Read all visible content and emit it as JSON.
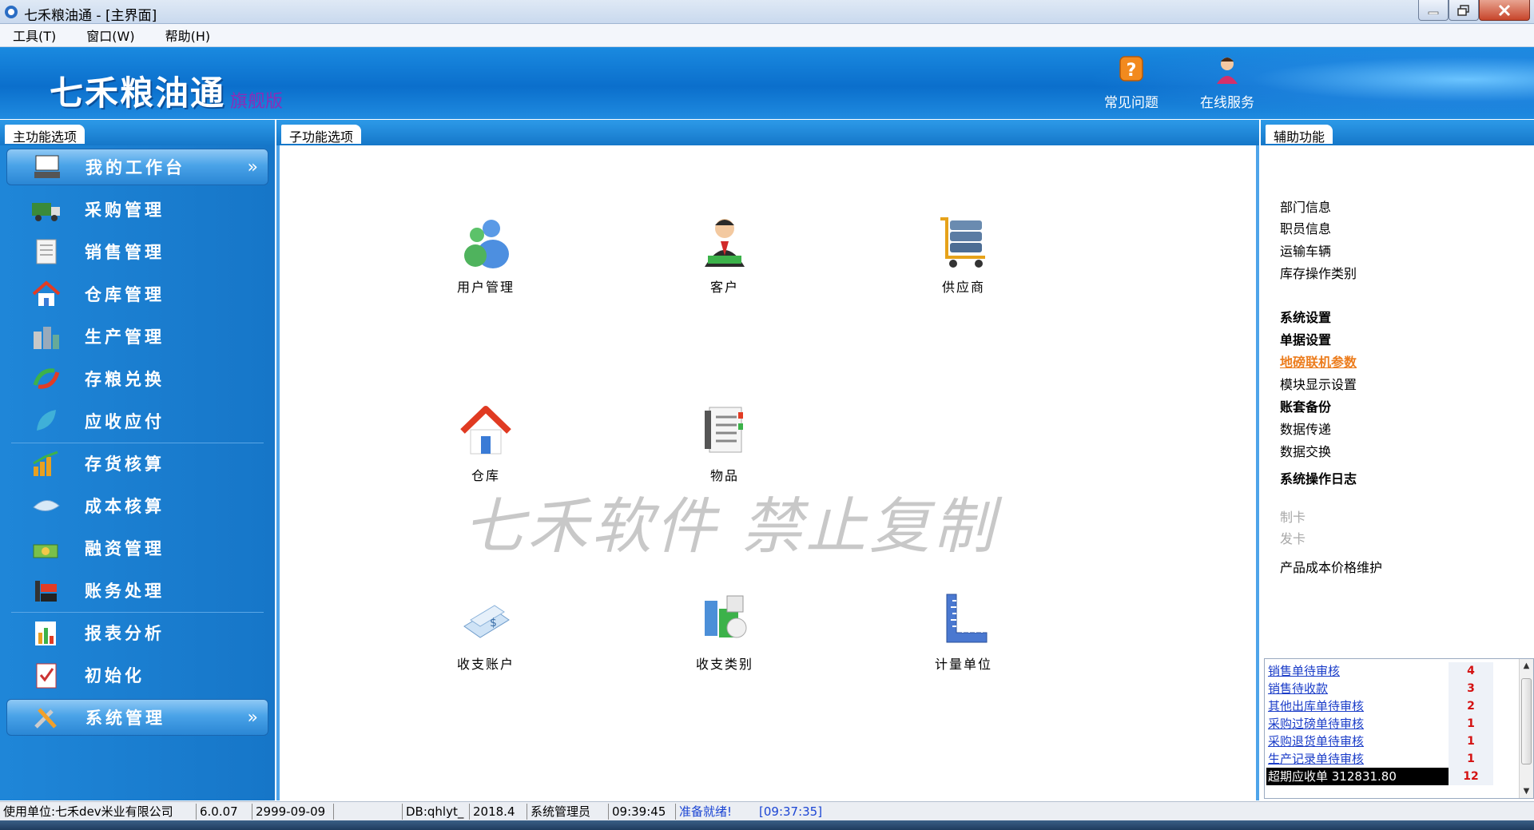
{
  "window": {
    "title": "七禾粮油通 - [主界面]"
  },
  "menu": [
    {
      "label": "工具(T)"
    },
    {
      "label": "窗口(W)"
    },
    {
      "label": "帮助(H)"
    }
  ],
  "banner": {
    "logo": "七禾粮油通",
    "edition": "旗舰版",
    "faq_label": "常见问题",
    "online_label": "在线服务"
  },
  "panels": {
    "main_header": "主功能选项",
    "sub_header": "子功能选项",
    "aux_header": "辅助功能"
  },
  "nav": [
    {
      "label": "我的工作台",
      "icon": "workbench-icon",
      "group": true
    },
    {
      "label": "采购管理",
      "icon": "truck-icon"
    },
    {
      "label": "销售管理",
      "icon": "notebook-icon"
    },
    {
      "label": "仓库管理",
      "icon": "house-icon"
    },
    {
      "label": "生产管理",
      "icon": "factory-icon"
    },
    {
      "label": "存粮兑换",
      "icon": "exchange-icon"
    },
    {
      "label": "应收应付",
      "icon": "leaf-icon"
    },
    {
      "label": "存货核算",
      "icon": "growth-chart-icon"
    },
    {
      "label": "成本核算",
      "icon": "ribbon-icon"
    },
    {
      "label": "融资管理",
      "icon": "money-icon"
    },
    {
      "label": "账务处理",
      "icon": "books-icon"
    },
    {
      "label": "报表分析",
      "icon": "bar-chart-icon"
    },
    {
      "label": "初始化",
      "icon": "clipboard-icon"
    },
    {
      "label": "系统管理",
      "icon": "tools-icon",
      "group": true
    }
  ],
  "functions": [
    {
      "label": "用户管理",
      "icon": "users-icon"
    },
    {
      "label": "客户",
      "icon": "customer-icon"
    },
    {
      "label": "供应商",
      "icon": "supplier-cart-icon"
    },
    {
      "label": "仓库",
      "icon": "warehouse-house-icon"
    },
    {
      "label": "物品",
      "icon": "item-list-icon"
    },
    {
      "label": "收支账户",
      "icon": "account-card-icon"
    },
    {
      "label": "收支类别",
      "icon": "category-box-icon"
    },
    {
      "label": "计量单位",
      "icon": "ruler-icon"
    }
  ],
  "watermark": "七禾软件  禁止复制",
  "aux": {
    "department": "部门信息",
    "staff": "职员信息",
    "vehicle": "运输车辆",
    "stock_op_type": "库存操作类别",
    "system_settings": "系统设置",
    "doc_settings": "单据设置",
    "scale_params": "地磅联机参数",
    "module_display": "模块显示设置",
    "backup": "账套备份",
    "data_transfer": "数据传递",
    "data_exchange": "数据交换",
    "op_log": "系统操作日志",
    "make_card": "制卡",
    "issue_card": "发卡",
    "cost_price": "产品成本价格维护"
  },
  "pending": [
    {
      "label": "销售单待审核",
      "count": "4"
    },
    {
      "label": "销售待收款",
      "count": "3"
    },
    {
      "label": "其他出库单待审核",
      "count": "2"
    },
    {
      "label": "采购过磅单待审核",
      "count": "1"
    },
    {
      "label": "采购退货单待审核",
      "count": "1"
    },
    {
      "label": "生产记录单待审核",
      "count": "1"
    },
    {
      "label": "超期应收单 312831.80",
      "count": "12"
    }
  ],
  "status": {
    "unit": "使用单位:七禾dev米业有限公司",
    "version": "6.0.07",
    "expiry": "2999-09-09",
    "blank": "",
    "db": "DB:qhlyt_",
    "period": "2018.4",
    "user": "系统管理员",
    "time": "09:39:45",
    "ready": "准备就绪!",
    "timestamp": "[09:37:35]"
  },
  "colors": {
    "banner_blue": "#0b6fcc",
    "sidebar_blue": "#1f86d8",
    "link_blue": "#1a3cc8",
    "count_red": "#d41111",
    "aux_orange": "#ec7c1c"
  }
}
